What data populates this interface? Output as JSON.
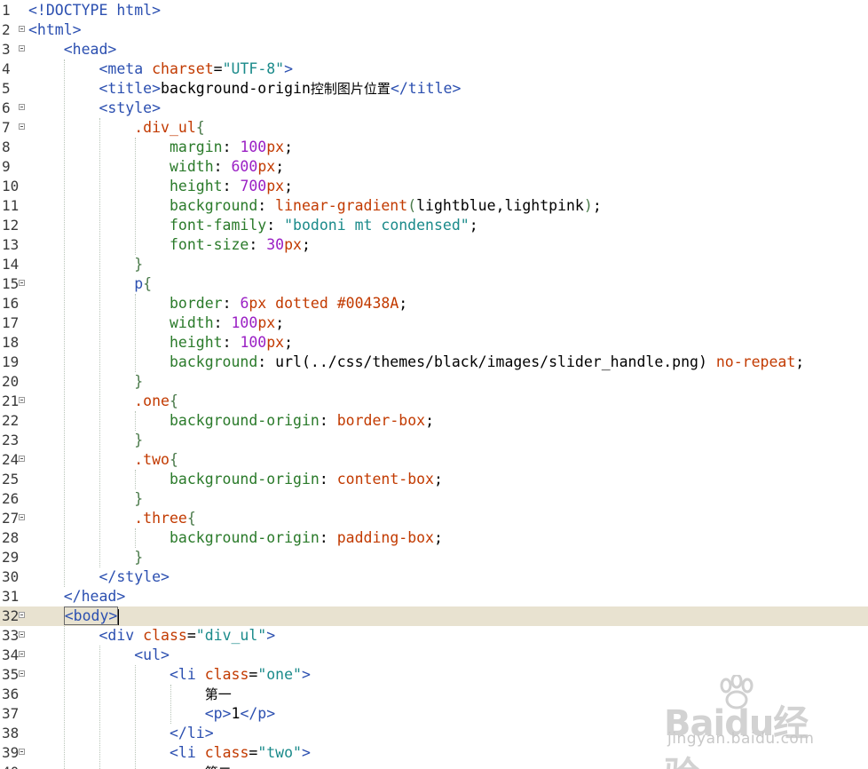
{
  "editor": {
    "current_line": 32,
    "lines": [
      {
        "num": "1",
        "fold": false,
        "tokens": [
          {
            "c": "t-tag",
            "t": "<!DOCTYPE html>"
          }
        ]
      },
      {
        "num": "2",
        "fold": true,
        "tokens": [
          {
            "c": "t-tag",
            "t": "<html>"
          }
        ]
      },
      {
        "num": "3",
        "fold": true,
        "tokens": [
          {
            "c": "t-plain",
            "t": "    "
          },
          {
            "c": "t-tag",
            "t": "<head>"
          }
        ]
      },
      {
        "num": "4",
        "fold": false,
        "tokens": [
          {
            "c": "t-plain",
            "t": "        "
          },
          {
            "c": "t-tag",
            "t": "<meta "
          },
          {
            "c": "t-attr",
            "t": "charset"
          },
          {
            "c": "t-plain",
            "t": "="
          },
          {
            "c": "t-str",
            "t": "\"UTF-8\""
          },
          {
            "c": "t-tag",
            "t": ">"
          }
        ]
      },
      {
        "num": "5",
        "fold": false,
        "tokens": [
          {
            "c": "t-plain",
            "t": "        "
          },
          {
            "c": "t-tag",
            "t": "<title>"
          },
          {
            "c": "t-plain",
            "t": "background-origin"
          },
          {
            "c": "t-cn",
            "t": "控制图片位置"
          },
          {
            "c": "t-tag",
            "t": "</title>"
          }
        ]
      },
      {
        "num": "6",
        "fold": true,
        "tokens": [
          {
            "c": "t-plain",
            "t": "        "
          },
          {
            "c": "t-tag",
            "t": "<style>"
          }
        ]
      },
      {
        "num": "7",
        "fold": true,
        "tokens": [
          {
            "c": "t-plain",
            "t": "            "
          },
          {
            "c": "t-sel",
            "t": ".div_ul"
          },
          {
            "c": "t-brace",
            "t": "{"
          }
        ]
      },
      {
        "num": "8",
        "fold": false,
        "tokens": [
          {
            "c": "t-plain",
            "t": "                "
          },
          {
            "c": "t-prop",
            "t": "margin"
          },
          {
            "c": "t-plain",
            "t": ": "
          },
          {
            "c": "t-num",
            "t": "100"
          },
          {
            "c": "t-kw",
            "t": "px"
          },
          {
            "c": "t-plain",
            "t": ";"
          }
        ]
      },
      {
        "num": "9",
        "fold": false,
        "tokens": [
          {
            "c": "t-plain",
            "t": "                "
          },
          {
            "c": "t-prop",
            "t": "width"
          },
          {
            "c": "t-plain",
            "t": ": "
          },
          {
            "c": "t-num",
            "t": "600"
          },
          {
            "c": "t-kw",
            "t": "px"
          },
          {
            "c": "t-plain",
            "t": ";"
          }
        ]
      },
      {
        "num": "10",
        "fold": false,
        "tokens": [
          {
            "c": "t-plain",
            "t": "                "
          },
          {
            "c": "t-prop",
            "t": "height"
          },
          {
            "c": "t-plain",
            "t": ": "
          },
          {
            "c": "t-num",
            "t": "700"
          },
          {
            "c": "t-kw",
            "t": "px"
          },
          {
            "c": "t-plain",
            "t": ";"
          }
        ]
      },
      {
        "num": "11",
        "fold": false,
        "tokens": [
          {
            "c": "t-plain",
            "t": "                "
          },
          {
            "c": "t-prop",
            "t": "background"
          },
          {
            "c": "t-plain",
            "t": ": "
          },
          {
            "c": "t-kw",
            "t": "linear-gradient"
          },
          {
            "c": "t-brace",
            "t": "("
          },
          {
            "c": "t-plain",
            "t": "lightblue,lightpink"
          },
          {
            "c": "t-brace",
            "t": ")"
          },
          {
            "c": "t-plain",
            "t": ";"
          }
        ]
      },
      {
        "num": "12",
        "fold": false,
        "tokens": [
          {
            "c": "t-plain",
            "t": "                "
          },
          {
            "c": "t-prop",
            "t": "font-family"
          },
          {
            "c": "t-plain",
            "t": ": "
          },
          {
            "c": "t-str",
            "t": "\"bodoni mt condensed\""
          },
          {
            "c": "t-plain",
            "t": ";"
          }
        ]
      },
      {
        "num": "13",
        "fold": false,
        "tokens": [
          {
            "c": "t-plain",
            "t": "                "
          },
          {
            "c": "t-prop",
            "t": "font-size"
          },
          {
            "c": "t-plain",
            "t": ": "
          },
          {
            "c": "t-num",
            "t": "30"
          },
          {
            "c": "t-kw",
            "t": "px"
          },
          {
            "c": "t-plain",
            "t": ";"
          }
        ]
      },
      {
        "num": "14",
        "fold": false,
        "tokens": [
          {
            "c": "t-plain",
            "t": "            "
          },
          {
            "c": "t-brace",
            "t": "}"
          }
        ]
      },
      {
        "num": "15",
        "fold": true,
        "tokens": [
          {
            "c": "t-plain",
            "t": "            "
          },
          {
            "c": "t-tag",
            "t": "p"
          },
          {
            "c": "t-brace",
            "t": "{"
          }
        ]
      },
      {
        "num": "16",
        "fold": false,
        "tokens": [
          {
            "c": "t-plain",
            "t": "                "
          },
          {
            "c": "t-prop",
            "t": "border"
          },
          {
            "c": "t-plain",
            "t": ": "
          },
          {
            "c": "t-num",
            "t": "6"
          },
          {
            "c": "t-kw",
            "t": "px dotted #00438A"
          },
          {
            "c": "t-plain",
            "t": ";"
          }
        ]
      },
      {
        "num": "17",
        "fold": false,
        "tokens": [
          {
            "c": "t-plain",
            "t": "                "
          },
          {
            "c": "t-prop",
            "t": "width"
          },
          {
            "c": "t-plain",
            "t": ": "
          },
          {
            "c": "t-num",
            "t": "100"
          },
          {
            "c": "t-kw",
            "t": "px"
          },
          {
            "c": "t-plain",
            "t": ";"
          }
        ]
      },
      {
        "num": "18",
        "fold": false,
        "tokens": [
          {
            "c": "t-plain",
            "t": "                "
          },
          {
            "c": "t-prop",
            "t": "height"
          },
          {
            "c": "t-plain",
            "t": ": "
          },
          {
            "c": "t-num",
            "t": "100"
          },
          {
            "c": "t-kw",
            "t": "px"
          },
          {
            "c": "t-plain",
            "t": ";"
          }
        ]
      },
      {
        "num": "19",
        "fold": false,
        "tokens": [
          {
            "c": "t-plain",
            "t": "                "
          },
          {
            "c": "t-prop",
            "t": "background"
          },
          {
            "c": "t-plain",
            "t": ": url(../css/themes/black/images/slider_handle.png) "
          },
          {
            "c": "t-kw",
            "t": "no-repeat"
          },
          {
            "c": "t-plain",
            "t": ";"
          }
        ]
      },
      {
        "num": "20",
        "fold": false,
        "tokens": [
          {
            "c": "t-plain",
            "t": "            "
          },
          {
            "c": "t-brace",
            "t": "}"
          }
        ]
      },
      {
        "num": "21",
        "fold": true,
        "tokens": [
          {
            "c": "t-plain",
            "t": "            "
          },
          {
            "c": "t-sel",
            "t": ".one"
          },
          {
            "c": "t-brace",
            "t": "{"
          }
        ]
      },
      {
        "num": "22",
        "fold": false,
        "tokens": [
          {
            "c": "t-plain",
            "t": "                "
          },
          {
            "c": "t-prop",
            "t": "background-origin"
          },
          {
            "c": "t-plain",
            "t": ": "
          },
          {
            "c": "t-kw",
            "t": "border-box"
          },
          {
            "c": "t-plain",
            "t": ";"
          }
        ]
      },
      {
        "num": "23",
        "fold": false,
        "tokens": [
          {
            "c": "t-plain",
            "t": "            "
          },
          {
            "c": "t-brace",
            "t": "}"
          }
        ]
      },
      {
        "num": "24",
        "fold": true,
        "tokens": [
          {
            "c": "t-plain",
            "t": "            "
          },
          {
            "c": "t-sel",
            "t": ".two"
          },
          {
            "c": "t-brace",
            "t": "{"
          }
        ]
      },
      {
        "num": "25",
        "fold": false,
        "tokens": [
          {
            "c": "t-plain",
            "t": "                "
          },
          {
            "c": "t-prop",
            "t": "background-origin"
          },
          {
            "c": "t-plain",
            "t": ": "
          },
          {
            "c": "t-kw",
            "t": "content-box"
          },
          {
            "c": "t-plain",
            "t": ";"
          }
        ]
      },
      {
        "num": "26",
        "fold": false,
        "tokens": [
          {
            "c": "t-plain",
            "t": "            "
          },
          {
            "c": "t-brace",
            "t": "}"
          }
        ]
      },
      {
        "num": "27",
        "fold": true,
        "tokens": [
          {
            "c": "t-plain",
            "t": "            "
          },
          {
            "c": "t-sel",
            "t": ".three"
          },
          {
            "c": "t-brace",
            "t": "{"
          }
        ]
      },
      {
        "num": "28",
        "fold": false,
        "tokens": [
          {
            "c": "t-plain",
            "t": "                "
          },
          {
            "c": "t-prop",
            "t": "background-origin"
          },
          {
            "c": "t-plain",
            "t": ": "
          },
          {
            "c": "t-kw",
            "t": "padding-box"
          },
          {
            "c": "t-plain",
            "t": ";"
          }
        ]
      },
      {
        "num": "29",
        "fold": false,
        "tokens": [
          {
            "c": "t-plain",
            "t": "            "
          },
          {
            "c": "t-brace",
            "t": "}"
          }
        ]
      },
      {
        "num": "30",
        "fold": false,
        "tokens": [
          {
            "c": "t-plain",
            "t": "        "
          },
          {
            "c": "t-tag",
            "t": "</style>"
          }
        ]
      },
      {
        "num": "31",
        "fold": false,
        "tokens": [
          {
            "c": "t-plain",
            "t": "    "
          },
          {
            "c": "t-tag",
            "t": "</head>"
          }
        ]
      },
      {
        "num": "32",
        "fold": true,
        "tokens": [
          {
            "c": "t-plain",
            "t": "    "
          },
          {
            "c": "t-tag cursor-box",
            "t": "<body>"
          }
        ]
      },
      {
        "num": "33",
        "fold": true,
        "tokens": [
          {
            "c": "t-plain",
            "t": "        "
          },
          {
            "c": "t-tag",
            "t": "<div "
          },
          {
            "c": "t-attr",
            "t": "class"
          },
          {
            "c": "t-plain",
            "t": "="
          },
          {
            "c": "t-str",
            "t": "\"div_ul\""
          },
          {
            "c": "t-tag",
            "t": ">"
          }
        ]
      },
      {
        "num": "34",
        "fold": true,
        "tokens": [
          {
            "c": "t-plain",
            "t": "            "
          },
          {
            "c": "t-tag",
            "t": "<ul>"
          }
        ]
      },
      {
        "num": "35",
        "fold": true,
        "tokens": [
          {
            "c": "t-plain",
            "t": "                "
          },
          {
            "c": "t-tag",
            "t": "<li "
          },
          {
            "c": "t-attr",
            "t": "class"
          },
          {
            "c": "t-plain",
            "t": "="
          },
          {
            "c": "t-str",
            "t": "\"one\""
          },
          {
            "c": "t-tag",
            "t": ">"
          }
        ]
      },
      {
        "num": "36",
        "fold": false,
        "tokens": [
          {
            "c": "t-plain",
            "t": "                    "
          },
          {
            "c": "t-cn",
            "t": "第一"
          }
        ]
      },
      {
        "num": "37",
        "fold": false,
        "tokens": [
          {
            "c": "t-plain",
            "t": "                    "
          },
          {
            "c": "t-tag",
            "t": "<p>"
          },
          {
            "c": "t-plain",
            "t": "1"
          },
          {
            "c": "t-tag",
            "t": "</p>"
          }
        ]
      },
      {
        "num": "38",
        "fold": false,
        "tokens": [
          {
            "c": "t-plain",
            "t": "                "
          },
          {
            "c": "t-tag",
            "t": "</li>"
          }
        ]
      },
      {
        "num": "39",
        "fold": true,
        "tokens": [
          {
            "c": "t-plain",
            "t": "                "
          },
          {
            "c": "t-tag",
            "t": "<li "
          },
          {
            "c": "t-attr",
            "t": "class"
          },
          {
            "c": "t-plain",
            "t": "="
          },
          {
            "c": "t-str",
            "t": "\"two\""
          },
          {
            "c": "t-tag",
            "t": ">"
          }
        ]
      },
      {
        "num": "40",
        "fold": false,
        "tokens": [
          {
            "c": "t-plain",
            "t": "                    "
          },
          {
            "c": "t-cn",
            "t": "第二"
          }
        ]
      }
    ]
  },
  "watermark": {
    "logo_text": "Baidu经验",
    "url": "jingyan.baidu.com"
  },
  "colors": {
    "current_line_bg": "#e8e2d0",
    "tag": "#2b4fb0",
    "attr": "#c23a00",
    "string": "#1a8a8a",
    "property": "#2a7a2a",
    "number": "#9a1fc4"
  }
}
